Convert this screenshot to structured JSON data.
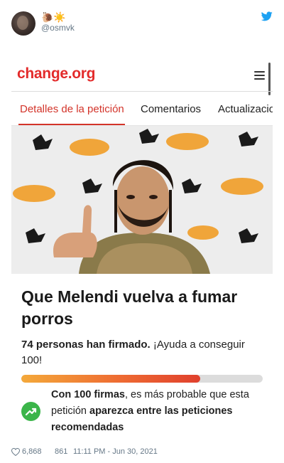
{
  "tweet": {
    "display_name": "🐌☀️",
    "handle": "@osmvk",
    "likes": "6,868",
    "retweets": "861",
    "timestamp": "11:11 PM - Jun 30, 2021",
    "icons": {
      "brand": "twitter-bird-icon",
      "like": "heart-icon"
    }
  },
  "site": {
    "logo": "change.org",
    "menu_icon": "hamburger-icon",
    "brand_color": "#e32b2b"
  },
  "tabs": [
    {
      "label": "Detalles de la petición",
      "active": true
    },
    {
      "label": "Comentarios",
      "active": false
    },
    {
      "label": "Actualizaciones",
      "active": false
    }
  ],
  "photo": {
    "backdrop_brand": "lotte"
  },
  "petition": {
    "title": "Que Melendi vuelva a fumar porros",
    "signed_bold": "74 personas han firmado.",
    "signed_rest": " ¡Ayuda a conseguir 100!",
    "progress_fraction": 0.74,
    "recommend_bold_1": "Con 100 firmas",
    "recommend_text_1": ", es más probable que esta petición ",
    "recommend_bold_2": "aparezca entre las peticiones recomendadas",
    "trend_icon": "trending-up-icon"
  }
}
